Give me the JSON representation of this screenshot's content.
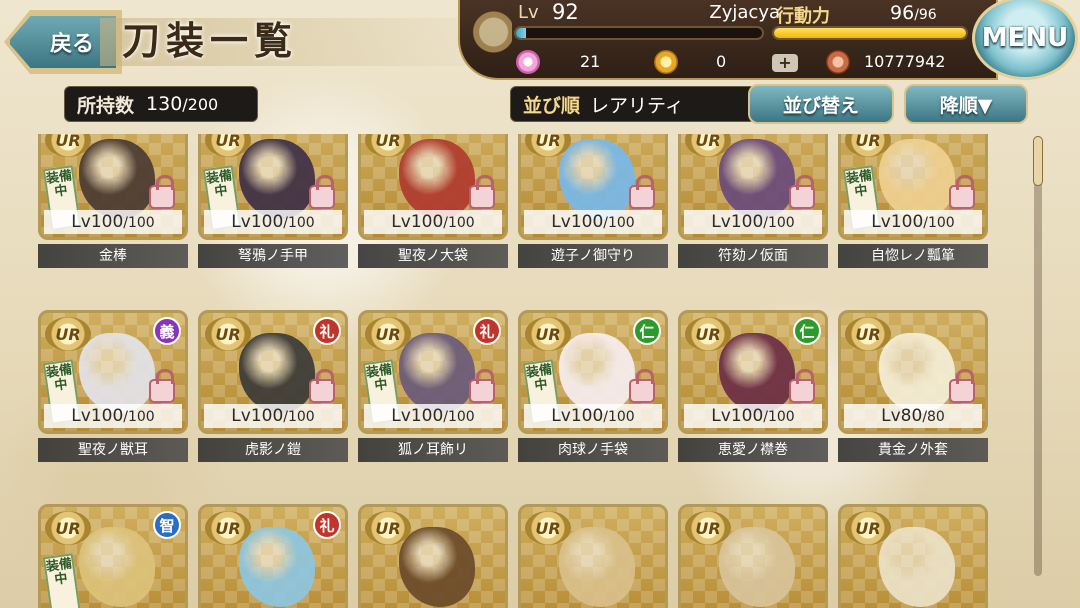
{
  "header": {
    "back_label": "戻る",
    "title": "刀装一覧",
    "menu_label": "MENU"
  },
  "status": {
    "lv_label": "Lv",
    "lv_value": "92",
    "player_name": "Zyjacya",
    "stamina_label": "行動力",
    "stamina_current": "96",
    "stamina_max": "/96",
    "stamina_fraction": 1.0,
    "gems": "21",
    "coins": "0",
    "money": "10777942",
    "plus_label": "+"
  },
  "inventory": {
    "count_label": "所持数",
    "count_current": "130",
    "count_max": "/200"
  },
  "sort": {
    "label": "並び順",
    "value": "レアリティ",
    "sort_button": "並び替え",
    "order_button": "降順▼"
  },
  "rarity_label": "UR",
  "equipped_label": "装備中",
  "colors": {
    "gi": "#8a35b8",
    "rei": "#c0352a",
    "jin": "#2f9a2c",
    "chi": "#2b6cc4"
  },
  "cards": [
    {
      "name": "金棒",
      "level": "Lv100",
      "max": "/100",
      "attr": "",
      "attr_color": "",
      "equipped": true,
      "art": "#4a3a32"
    },
    {
      "name": "弩鴉ノ手甲",
      "level": "Lv100",
      "max": "/100",
      "attr": "",
      "attr_color": "",
      "equipped": true,
      "art": "#3e2f46"
    },
    {
      "name": "聖夜ノ大袋",
      "level": "Lv100",
      "max": "/100",
      "attr": "",
      "attr_color": "",
      "equipped": false,
      "art": "#b03a2e"
    },
    {
      "name": "遊子ノ御守り",
      "level": "Lv100",
      "max": "/100",
      "attr": "",
      "attr_color": "",
      "equipped": false,
      "art": "#78b8e8"
    },
    {
      "name": "符劾ノ仮面",
      "level": "Lv100",
      "max": "/100",
      "attr": "",
      "attr_color": "",
      "equipped": false,
      "art": "#6a4a7a"
    },
    {
      "name": "自惚レノ瓢箪",
      "level": "Lv100",
      "max": "/100",
      "attr": "",
      "attr_color": "",
      "equipped": true,
      "art": "#f0d090"
    },
    {
      "name": "聖夜ノ獣耳",
      "level": "Lv100",
      "max": "/100",
      "attr": "義",
      "attr_color": "#8a35b8",
      "equipped": true,
      "art": "#e3e3ea"
    },
    {
      "name": "虎影ノ鎧",
      "level": "Lv100",
      "max": "/100",
      "attr": "礼",
      "attr_color": "#c0352a",
      "equipped": false,
      "art": "#3a3a38"
    },
    {
      "name": "狐ノ耳飾リ",
      "level": "Lv100",
      "max": "/100",
      "attr": "礼",
      "attr_color": "#c0352a",
      "equipped": true,
      "art": "#6a5a7a"
    },
    {
      "name": "肉球ノ手袋",
      "level": "Lv100",
      "max": "/100",
      "attr": "仁",
      "attr_color": "#2f9a2c",
      "equipped": true,
      "art": "#f7eef0"
    },
    {
      "name": "恵愛ノ襟巻",
      "level": "Lv100",
      "max": "/100",
      "attr": "仁",
      "attr_color": "#2f9a2c",
      "equipped": false,
      "art": "#6b2d45"
    },
    {
      "name": "貴金ノ外套",
      "level": "Lv80",
      "max": "/80",
      "attr": "",
      "attr_color": "",
      "equipped": false,
      "art": "#f5efd8"
    },
    {
      "name": "",
      "level": "",
      "max": "",
      "attr": "智",
      "attr_color": "#2b6cc4",
      "equipped": true,
      "art": "#dcc27a"
    },
    {
      "name": "",
      "level": "",
      "max": "",
      "attr": "礼",
      "attr_color": "#c0352a",
      "equipped": false,
      "art": "#8cc6e0"
    },
    {
      "name": "",
      "level": "",
      "max": "",
      "attr": "",
      "attr_color": "",
      "equipped": false,
      "art": "#6b4a2a"
    },
    {
      "name": "",
      "level": "",
      "max": "",
      "attr": "",
      "attr_color": "",
      "equipped": false,
      "art": "#d9c08a"
    },
    {
      "name": "",
      "level": "",
      "max": "",
      "attr": "",
      "attr_color": "",
      "equipped": false,
      "art": "#d8c49a"
    },
    {
      "name": "",
      "level": "",
      "max": "",
      "attr": "",
      "attr_color": "",
      "equipped": false,
      "art": "#ece2c8"
    }
  ]
}
